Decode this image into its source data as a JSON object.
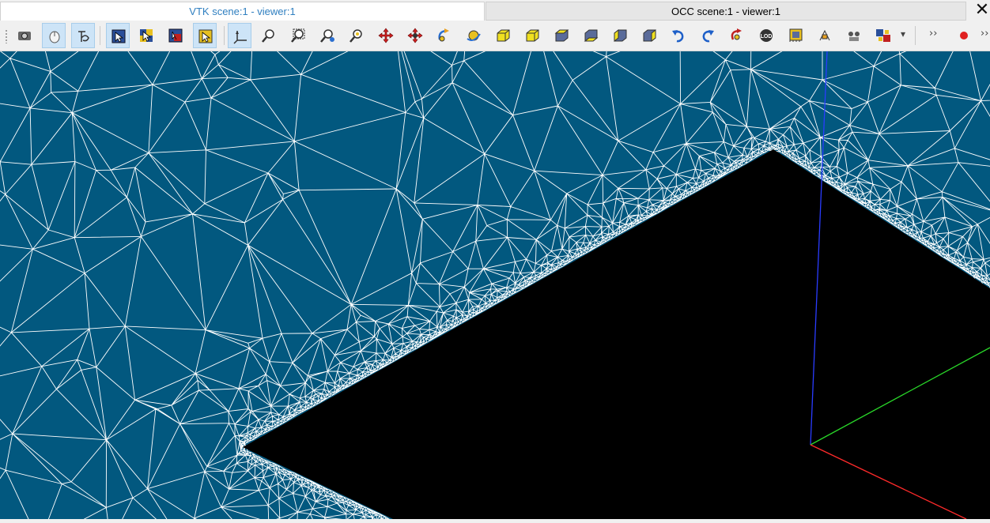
{
  "tabs": [
    {
      "label": "VTK scene:1 - viewer:1",
      "active": true
    },
    {
      "label": "OCC scene:1 - viewer:1",
      "active": false
    }
  ],
  "close_glyph": "✕",
  "toolbar": {
    "overflow_glyph": "››",
    "overflow_glyph_right": "››",
    "dropdown_glyph": "▾",
    "buttons": [
      {
        "icon": "dump-view-icon",
        "pressed": false
      },
      {
        "icon": "mouse-interaction-style-icon",
        "pressed": true
      },
      {
        "icon": "keyboard-free-interaction-icon",
        "pressed": true
      },
      {
        "icon": "selection-rectangle-icon",
        "pressed": true
      },
      {
        "icon": "selection-polygon-icon",
        "pressed": false
      },
      {
        "icon": "selection-circle-icon",
        "pressed": false
      },
      {
        "icon": "select-mode-icon",
        "pressed": true
      },
      {
        "icon": "trihedron-icon",
        "pressed": true
      },
      {
        "icon": "fit-all-icon",
        "pressed": false
      },
      {
        "icon": "fit-area-icon",
        "pressed": false
      },
      {
        "icon": "fit-selection-icon",
        "pressed": false
      },
      {
        "icon": "zoom-icon",
        "pressed": false
      },
      {
        "icon": "pan-icon",
        "pressed": false
      },
      {
        "icon": "global-pan-icon",
        "pressed": false
      },
      {
        "icon": "rotate-icon",
        "pressed": false
      },
      {
        "icon": "rotation-point-icon",
        "pressed": false
      },
      {
        "icon": "view-front-icon",
        "pressed": false
      },
      {
        "icon": "view-back-icon",
        "pressed": false
      },
      {
        "icon": "view-top-icon",
        "pressed": false
      },
      {
        "icon": "view-bottom-icon",
        "pressed": false
      },
      {
        "icon": "view-left-icon",
        "pressed": false
      },
      {
        "icon": "view-right-icon",
        "pressed": false
      },
      {
        "icon": "rotate-anticlockwise-icon",
        "pressed": false
      },
      {
        "icon": "rotate-clockwise-icon",
        "pressed": false
      },
      {
        "icon": "reset-view-icon",
        "pressed": false
      },
      {
        "icon": "lod-icon",
        "pressed": false
      },
      {
        "icon": "graduated-axes-icon",
        "pressed": false
      },
      {
        "icon": "perspective-icon",
        "pressed": false
      },
      {
        "icon": "stereo-icon",
        "pressed": false
      },
      {
        "icon": "projection-mode-icon",
        "pressed": false
      },
      {
        "icon": "record-icon",
        "pressed": false
      }
    ]
  },
  "viewer": {
    "background_color": "#02587f",
    "mesh_line_color": "#ffffff",
    "hole_color": "#000000",
    "axes": {
      "x_color": "#ff2a2a",
      "y_color": "#29d829",
      "z_color": "#2a3cff"
    }
  }
}
